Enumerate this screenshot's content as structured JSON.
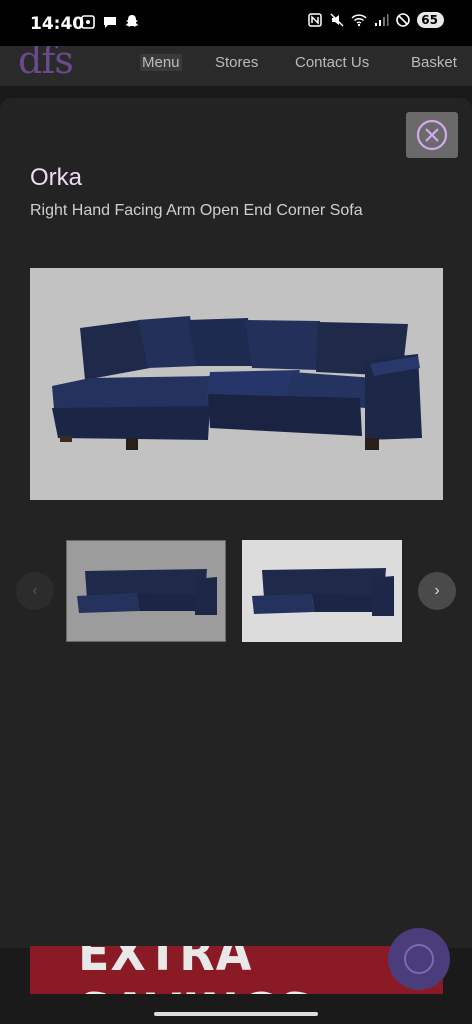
{
  "status_bar": {
    "time": "14:40",
    "battery": "65"
  },
  "site_header": {
    "logo": "dfs",
    "nav": {
      "menu": "Menu",
      "stores": "Stores",
      "contact": "Contact Us",
      "basket": "Basket"
    }
  },
  "modal": {
    "title": "Orka",
    "subtitle": "Right Hand Facing Arm Open End Corner Sofa",
    "prev_label": "‹",
    "next_label": "›"
  },
  "banner": {
    "text": "EXTRA SAVINGS"
  },
  "colors": {
    "accent": "#f0d9f5",
    "logo": "#6b4a8a",
    "banner": "#8a1a24",
    "sofa": "#1f2a4a"
  }
}
